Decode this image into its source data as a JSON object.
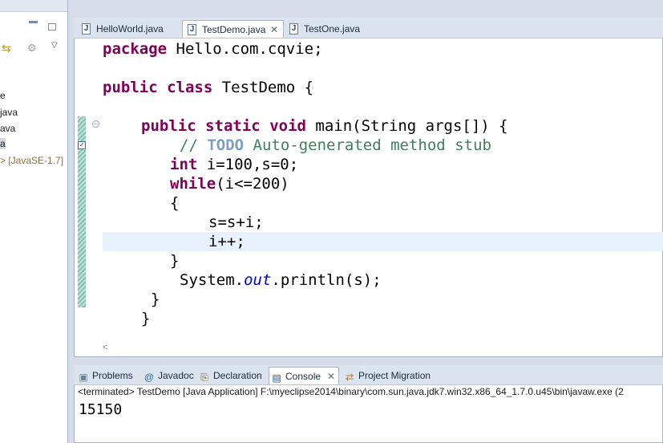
{
  "explorer": {
    "tree": [
      {
        "label": "e",
        "selected": false,
        "lib": false
      },
      {
        "label": "java",
        "selected": false,
        "lib": false
      },
      {
        "label": "ava",
        "selected": false,
        "lib": false
      },
      {
        "label": "a",
        "selected": true,
        "lib": false
      },
      {
        "label": "> [JavaSE-1.7]",
        "selected": false,
        "lib": true
      }
    ]
  },
  "editor": {
    "tabs": [
      {
        "label": "HelloWorld.java",
        "active": false
      },
      {
        "label": "TestDemo.java",
        "active": true
      },
      {
        "label": "TestOne.java",
        "active": false
      }
    ],
    "close_glyph": "✕",
    "scroll_left_glyph": "<",
    "code": {
      "l1_kw": "package",
      "l1_rest": " Hello.com.cqvie;",
      "l2_kw1": "public",
      "l2_kw2": "class",
      "l2_rest": " TestDemo {",
      "l3_kw1": "public",
      "l3_kw2": "static",
      "l3_kw3": "void",
      "l3_rest": " main(String args[]) {",
      "l4_cm1": "// ",
      "l4_todo": "TODO",
      "l4_cm2": " Auto-generated method stub",
      "l5_kw": "int",
      "l5_rest": " i=100,s=0;",
      "l6_kw": "while",
      "l6_rest": "(i<=200)",
      "l7": "{",
      "l8": "s=s+i;",
      "l9": "i++;",
      "l10": "}",
      "l11_a": "System.",
      "l11_fld": "out",
      "l11_b": ".println(s);",
      "l12": "}",
      "l13": "}"
    }
  },
  "views": {
    "tabs": [
      {
        "label": "Problems",
        "icon": "problems-icon",
        "glyph": "▣",
        "active": false
      },
      {
        "label": "Javadoc",
        "icon": "javadoc-icon",
        "glyph": "@",
        "active": false
      },
      {
        "label": "Declaration",
        "icon": "declaration-icon",
        "glyph": "⎘",
        "active": false
      },
      {
        "label": "Console",
        "icon": "console-icon",
        "glyph": "▤",
        "active": true
      },
      {
        "label": "Project Migration",
        "icon": "project-migration-icon",
        "glyph": "⇄",
        "active": false
      }
    ],
    "terminated_line": "<terminated> TestDemo [Java Application] F:\\myeclipse2014\\binary\\com.sun.java.jdk7.win32.x86_64_1.7.0.u45\\bin\\javaw.exe (2",
    "output": "15150"
  }
}
